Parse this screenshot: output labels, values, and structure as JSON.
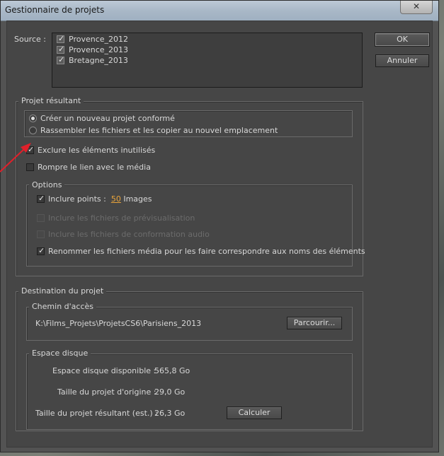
{
  "window": {
    "title": "Gestionnaire de projets",
    "close_glyph": "✕"
  },
  "buttons": {
    "ok": "OK",
    "cancel": "Annuler",
    "browse": "Parcourir...",
    "calculate": "Calculer"
  },
  "source": {
    "label": "Source :",
    "items": [
      {
        "label": "Provence_2012",
        "checked": true
      },
      {
        "label": "Provence_2013",
        "checked": true
      },
      {
        "label": "Bretagne_2013",
        "checked": true
      }
    ]
  },
  "result": {
    "legend": "Projet résultant",
    "radio_new": "Créer un nouveau projet conformé",
    "radio_collect": "Rassembler les fichiers et les copier au nouvel emplacement",
    "exclude_unused": "Exclure les éléments inutilisés",
    "break_link": "Rompre le lien avec le média"
  },
  "options": {
    "legend": "Options",
    "include_points_prefix": "Inclure points :",
    "include_points_value": "50",
    "include_points_suffix": "Images",
    "include_preview": "Inclure les fichiers de prévisualisation",
    "include_audio": "Inclure les fichiers de conformation audio",
    "rename_media": "Renommer les fichiers média pour les faire correspondre aux noms des éléments"
  },
  "destination": {
    "legend": "Destination du projet",
    "path_legend": "Chemin d'accès",
    "path": "K:\\Films_Projets\\ProjetsCS6\\Parisiens_2013"
  },
  "disk": {
    "legend": "Espace disque",
    "available_label": "Espace disque disponible :",
    "available_value": "565,8 Go",
    "origin_label": "Taille du projet d'origine :",
    "origin_value": "29,0 Go",
    "result_label": "Taille du projet résultant (est.) :",
    "result_value": "26,3 Go"
  },
  "colors": {
    "annotation_arrow": "#e0202a",
    "hotlink": "#e8a33a"
  },
  "checkmark": "✓"
}
